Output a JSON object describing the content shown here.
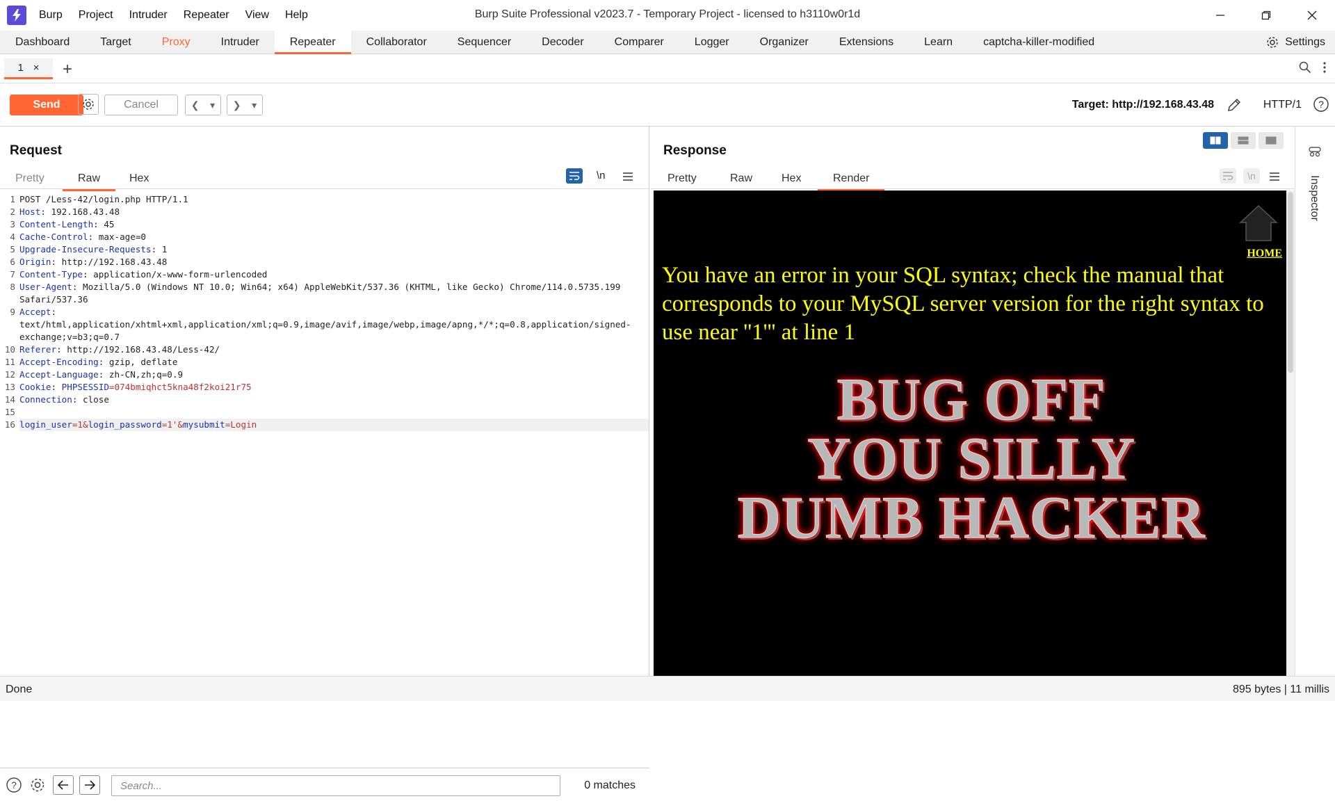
{
  "window": {
    "title": "Burp Suite Professional v2023.7 - Temporary Project - licensed to h3110w0r1d",
    "menu": [
      "Burp",
      "Project",
      "Intruder",
      "Repeater",
      "View",
      "Help"
    ]
  },
  "main_tabs": [
    "Dashboard",
    "Target",
    "Proxy",
    "Intruder",
    "Repeater",
    "Collaborator",
    "Sequencer",
    "Decoder",
    "Comparer",
    "Logger",
    "Organizer",
    "Extensions",
    "Learn",
    "captcha-killer-modified"
  ],
  "active_main_tab": "Repeater",
  "settings_label": "Settings",
  "repeater_tab": {
    "label": "1",
    "close": "×"
  },
  "toolbar": {
    "send_label": "Send",
    "cancel_label": "Cancel",
    "target_label": "Target: http://192.168.43.48",
    "http_version": "HTTP/1"
  },
  "request": {
    "title": "Request",
    "tabs": [
      "Pretty",
      "Raw",
      "Hex"
    ],
    "active_tab": "Raw",
    "newline_toggle": "\\n",
    "lines": [
      {
        "n": "1",
        "k": "",
        "v": "POST /Less-42/login.php HTTP/1.1"
      },
      {
        "n": "2",
        "k": "Host",
        "v": ": 192.168.43.48"
      },
      {
        "n": "3",
        "k": "Content-Length",
        "v": ": 45"
      },
      {
        "n": "4",
        "k": "Cache-Control",
        "v": ": max-age=0"
      },
      {
        "n": "5",
        "k": "Upgrade-Insecure-Requests",
        "v": ": 1"
      },
      {
        "n": "6",
        "k": "Origin",
        "v": ": http://192.168.43.48"
      },
      {
        "n": "7",
        "k": "Content-Type",
        "v": ": application/x-www-form-urlencoded"
      },
      {
        "n": "8",
        "k": "User-Agent",
        "v": ": Mozilla/5.0 (Windows NT 10.0; Win64; x64) AppleWebKit/537.36 (KHTML, like Gecko) Chrome/114.0.5735.199 Safari/537.36"
      },
      {
        "n": "9",
        "k": "Accept",
        "v": ":\ntext/html,application/xhtml+xml,application/xml;q=0.9,image/avif,image/webp,image/apng,*/*;q=0.8,application/signed-exchange;v=b3;q=0.7"
      },
      {
        "n": "10",
        "k": "Referer",
        "v": ": http://192.168.43.48/Less-42/"
      },
      {
        "n": "11",
        "k": "Accept-Encoding",
        "v": ": gzip, deflate"
      },
      {
        "n": "12",
        "k": "Accept-Language",
        "v": ": zh-CN,zh;q=0.9"
      },
      {
        "n": "13",
        "k": "Cookie",
        "v": ": ",
        "ck": "PHPSESSID",
        "cv": "=074bmiqhct5kna48f2koi21r75"
      },
      {
        "n": "14",
        "k": "Connection",
        "v": ": close"
      },
      {
        "n": "15",
        "k": "",
        "v": ""
      },
      {
        "n": "16",
        "body": true,
        "p1k": "login_user",
        "p1v": "=1&",
        "p2k": "login_password",
        "p2v": "=1'&",
        "p3k": "mysubmit",
        "p3v": "=Login"
      }
    ]
  },
  "search": {
    "placeholder": "Search...",
    "matches": "0 matches"
  },
  "response": {
    "title": "Response",
    "tabs": [
      "Pretty",
      "Raw",
      "Hex",
      "Render"
    ],
    "active_tab": "Render",
    "render": {
      "home_link": "HOME",
      "error_message": "You have an error in your SQL syntax; check the manual that corresponds to your MySQL server version for the right syntax to use near ''1''' at line 1",
      "banner_lines": [
        "BUG OFF",
        "YOU SILLY",
        "DUMB HACKER"
      ]
    }
  },
  "inspector_label": "Inspector",
  "status": {
    "left": "Done",
    "right": "895 bytes | 11 millis"
  },
  "colors": {
    "accent": "#ff6633",
    "error_text": "#ffff00",
    "header_key": "#1a33b3"
  }
}
